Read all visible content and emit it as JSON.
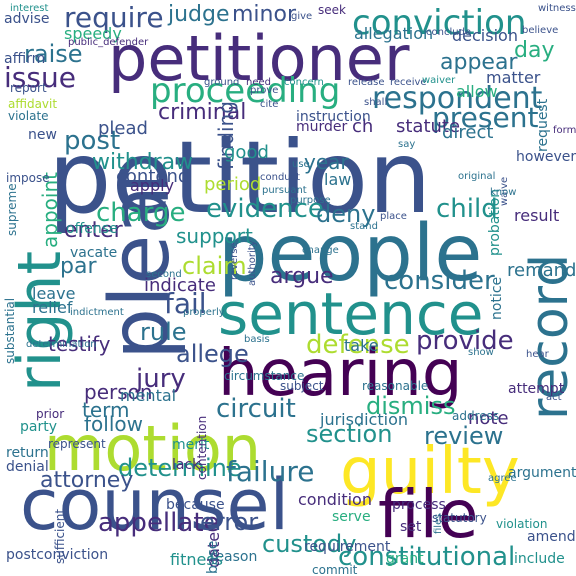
{
  "palette": {
    "dark_purple": "#440154",
    "purple": "#472d7b",
    "indigo": "#3b528b",
    "blue": "#2c728e",
    "teal": "#21918c",
    "green": "#28ae80",
    "light_green": "#5ec962",
    "lime": "#addc30",
    "yellow": "#fde725"
  },
  "words": [
    {
      "text": "petition",
      "color": "#3b528b",
      "orientation": "horizontal"
    },
    {
      "text": "petitioner",
      "color": "#472d7b",
      "orientation": "horizontal"
    },
    {
      "text": "people",
      "color": "#2c728e",
      "orientation": "horizontal"
    },
    {
      "text": "counsel",
      "color": "#3b528b",
      "orientation": "horizontal"
    },
    {
      "text": "hearing",
      "color": "#440154",
      "orientation": "horizontal"
    },
    {
      "text": "motion",
      "color": "#addc30",
      "orientation": "horizontal"
    },
    {
      "text": "sentence",
      "color": "#21918c",
      "orientation": "horizontal"
    },
    {
      "text": "plea",
      "color": "#3b528b",
      "orientation": "vertical"
    },
    {
      "text": "right",
      "color": "#21918c",
      "orientation": "vertical"
    },
    {
      "text": "guilty",
      "color": "#fde725",
      "orientation": "horizontal"
    },
    {
      "text": "file",
      "color": "#440154",
      "orientation": "horizontal"
    },
    {
      "text": "record",
      "color": "#2c728e",
      "orientation": "vertical"
    },
    {
      "text": "conviction",
      "color": "#21918c",
      "orientation": "horizontal"
    },
    {
      "text": "proceeding",
      "color": "#28ae80",
      "orientation": "horizontal"
    },
    {
      "text": "respondent",
      "color": "#2c728e",
      "orientation": "horizontal"
    },
    {
      "text": "evidence",
      "color": "#21918c",
      "orientation": "horizontal"
    },
    {
      "text": "require",
      "color": "#3b528b",
      "orientation": "horizontal"
    },
    {
      "text": "issue",
      "color": "#472d7b",
      "orientation": "horizontal"
    },
    {
      "text": "raise",
      "color": "#2c728e",
      "orientation": "horizontal"
    },
    {
      "text": "judge",
      "color": "#2c728e",
      "orientation": "horizontal"
    },
    {
      "text": "minor",
      "color": "#3b528b",
      "orientation": "horizontal"
    },
    {
      "text": "day",
      "color": "#28ae80",
      "orientation": "horizontal"
    },
    {
      "text": "appear",
      "color": "#2c728e",
      "orientation": "horizontal"
    },
    {
      "text": "present",
      "color": "#2c728e",
      "orientation": "horizontal"
    },
    {
      "text": "post",
      "color": "#2c728e",
      "orientation": "horizontal"
    },
    {
      "text": "criminal",
      "color": "#472d7b",
      "orientation": "horizontal"
    },
    {
      "text": "withdraw",
      "color": "#21918c",
      "orientation": "horizontal"
    },
    {
      "text": "appoint",
      "color": "#28ae80",
      "orientation": "vertical"
    },
    {
      "text": "charge",
      "color": "#28ae80",
      "orientation": "horizontal"
    },
    {
      "text": "deny",
      "color": "#2c728e",
      "orientation": "horizontal"
    },
    {
      "text": "child",
      "color": "#21918c",
      "orientation": "horizontal"
    },
    {
      "text": "enter",
      "color": "#472d7b",
      "orientation": "horizontal"
    },
    {
      "text": "support",
      "color": "#21918c",
      "orientation": "horizontal"
    },
    {
      "text": "claim",
      "color": "#addc30",
      "orientation": "horizontal"
    },
    {
      "text": "consider",
      "color": "#2c728e",
      "orientation": "horizontal"
    },
    {
      "text": "argue",
      "color": "#472d7b",
      "orientation": "horizontal"
    },
    {
      "text": "par",
      "color": "#2c728e",
      "orientation": "horizontal"
    },
    {
      "text": "fail",
      "color": "#3b528b",
      "orientation": "horizontal"
    },
    {
      "text": "rule",
      "color": "#2c728e",
      "orientation": "horizontal"
    },
    {
      "text": "defense",
      "color": "#addc30",
      "orientation": "horizontal"
    },
    {
      "text": "provide",
      "color": "#472d7b",
      "orientation": "horizontal"
    },
    {
      "text": "allege",
      "color": "#3b528b",
      "orientation": "horizontal"
    },
    {
      "text": "jury",
      "color": "#472d7b",
      "orientation": "horizontal"
    },
    {
      "text": "circuit",
      "color": "#2c728e",
      "orientation": "horizontal"
    },
    {
      "text": "dismiss",
      "color": "#28ae80",
      "orientation": "horizontal"
    },
    {
      "text": "section",
      "color": "#21918c",
      "orientation": "horizontal"
    },
    {
      "text": "review",
      "color": "#2c728e",
      "orientation": "horizontal"
    },
    {
      "text": "note",
      "color": "#472d7b",
      "orientation": "horizontal"
    },
    {
      "text": "determine",
      "color": "#21918c",
      "orientation": "horizontal"
    },
    {
      "text": "failure",
      "color": "#2c728e",
      "orientation": "horizontal"
    },
    {
      "text": "attorney",
      "color": "#3b528b",
      "orientation": "horizontal"
    },
    {
      "text": "appellate",
      "color": "#472d7b",
      "orientation": "horizontal"
    },
    {
      "text": "error",
      "color": "#3b528b",
      "orientation": "horizontal"
    },
    {
      "text": "custody",
      "color": "#21918c",
      "orientation": "horizontal"
    },
    {
      "text": "constitutional",
      "color": "#21918c",
      "orientation": "horizontal"
    },
    {
      "text": "person",
      "color": "#472d7b",
      "orientation": "horizontal"
    },
    {
      "text": "term",
      "color": "#2c728e",
      "orientation": "horizontal"
    },
    {
      "text": "follow",
      "color": "#2c728e",
      "orientation": "horizontal"
    },
    {
      "text": "testify",
      "color": "#472d7b",
      "orientation": "horizontal"
    },
    {
      "text": "finding",
      "color": "#3b528b",
      "orientation": "vertical"
    },
    {
      "text": "good",
      "color": "#21918c",
      "orientation": "horizontal"
    },
    {
      "text": "period",
      "color": "#addc30",
      "orientation": "horizontal"
    },
    {
      "text": "year",
      "color": "#2c728e",
      "orientation": "horizontal"
    },
    {
      "text": "ch",
      "color": "#472d7b",
      "orientation": "horizontal"
    },
    {
      "text": "statute",
      "color": "#472d7b",
      "orientation": "horizontal"
    },
    {
      "text": "direct",
      "color": "#2c728e",
      "orientation": "horizontal"
    },
    {
      "text": "plead",
      "color": "#3b528b",
      "orientation": "horizontal"
    },
    {
      "text": "contend",
      "color": "#3b528b",
      "orientation": "horizontal"
    },
    {
      "text": "apply",
      "color": "#472d7b",
      "orientation": "horizontal"
    },
    {
      "text": "law",
      "color": "#2c728e",
      "orientation": "horizontal"
    },
    {
      "text": "jurisdiction",
      "color": "#2c728e",
      "orientation": "horizontal"
    },
    {
      "text": "indicate",
      "color": "#472d7b",
      "orientation": "horizontal"
    },
    {
      "text": "mental",
      "color": "#2c728e",
      "orientation": "horizontal"
    },
    {
      "text": "take",
      "color": "#2c728e",
      "orientation": "horizontal"
    },
    {
      "text": "remand",
      "color": "#2c728e",
      "orientation": "horizontal"
    },
    {
      "text": "relief",
      "color": "#2c728e",
      "orientation": "horizontal"
    },
    {
      "text": "leave",
      "color": "#2c728e",
      "orientation": "horizontal"
    },
    {
      "text": "offense",
      "color": "#21918c",
      "orientation": "horizontal"
    },
    {
      "text": "vacate",
      "color": "#2c728e",
      "orientation": "horizontal"
    },
    {
      "text": "result",
      "color": "#472d7b",
      "orientation": "horizontal"
    },
    {
      "text": "probation",
      "color": "#21918c",
      "orientation": "vertical"
    },
    {
      "text": "notice",
      "color": "#2c728e",
      "orientation": "vertical"
    },
    {
      "text": "request",
      "color": "#2c728e",
      "orientation": "vertical"
    },
    {
      "text": "however",
      "color": "#3b528b",
      "orientation": "horizontal"
    },
    {
      "text": "matter",
      "color": "#3b528b",
      "orientation": "horizontal"
    },
    {
      "text": "allow",
      "color": "#28ae80",
      "orientation": "horizontal"
    },
    {
      "text": "instruction",
      "color": "#3b528b",
      "orientation": "horizontal"
    },
    {
      "text": "murder",
      "color": "#472d7b",
      "orientation": "horizontal"
    },
    {
      "text": "decision",
      "color": "#3b528b",
      "orientation": "horizontal"
    },
    {
      "text": "allegation",
      "color": "#2c728e",
      "orientation": "horizontal"
    },
    {
      "text": "affirm",
      "color": "#3b528b",
      "orientation": "horizontal"
    },
    {
      "text": "speedy",
      "color": "#28ae80",
      "orientation": "horizontal"
    },
    {
      "text": "advise",
      "color": "#3b528b",
      "orientation": "horizontal"
    },
    {
      "text": "because",
      "color": "#3b528b",
      "orientation": "horizontal"
    },
    {
      "text": "new",
      "color": "#3b528b",
      "orientation": "horizontal"
    },
    {
      "text": "merit",
      "color": "#21918c",
      "orientation": "horizontal"
    },
    {
      "text": "lack",
      "color": "#472d7b",
      "orientation": "horizontal"
    },
    {
      "text": "reason",
      "color": "#2c728e",
      "orientation": "horizontal"
    },
    {
      "text": "fitness",
      "color": "#21918c",
      "orientation": "horizontal"
    },
    {
      "text": "date",
      "color": "#472d7b",
      "orientation": "vertical"
    },
    {
      "text": "serve",
      "color": "#28ae80",
      "orientation": "horizontal"
    },
    {
      "text": "condition",
      "color": "#472d7b",
      "orientation": "horizontal"
    },
    {
      "text": "requirement",
      "color": "#3b528b",
      "orientation": "horizontal"
    },
    {
      "text": "process",
      "color": "#472d7b",
      "orientation": "horizontal"
    },
    {
      "text": "set",
      "color": "#472d7b",
      "orientation": "horizontal"
    },
    {
      "text": "grant",
      "color": "#28ae80",
      "orientation": "horizontal"
    },
    {
      "text": "include",
      "color": "#21918c",
      "orientation": "horizontal"
    },
    {
      "text": "amend",
      "color": "#3b528b",
      "orientation": "horizontal"
    },
    {
      "text": "violation",
      "color": "#21918c",
      "orientation": "horizontal"
    },
    {
      "text": "statutory",
      "color": "#3b528b",
      "orientation": "horizontal"
    },
    {
      "text": "argument",
      "color": "#2c728e",
      "orientation": "horizontal"
    },
    {
      "text": "attempt",
      "color": "#472d7b",
      "orientation": "horizontal"
    },
    {
      "text": "address",
      "color": "#2c728e",
      "orientation": "horizontal"
    },
    {
      "text": "reasonable",
      "color": "#2c728e",
      "orientation": "horizontal"
    },
    {
      "text": "subject",
      "color": "#3b528b",
      "orientation": "horizontal"
    },
    {
      "text": "circumstance",
      "color": "#2c728e",
      "orientation": "horizontal"
    },
    {
      "text": "represent",
      "color": "#3b528b",
      "orientation": "horizontal"
    },
    {
      "text": "prior",
      "color": "#472d7b",
      "orientation": "horizontal"
    },
    {
      "text": "party",
      "color": "#21918c",
      "orientation": "horizontal"
    },
    {
      "text": "return",
      "color": "#2c728e",
      "orientation": "horizontal"
    },
    {
      "text": "denial",
      "color": "#3b528b",
      "orientation": "horizontal"
    },
    {
      "text": "postconviction",
      "color": "#3b528b",
      "orientation": "horizontal"
    },
    {
      "text": "sufficient",
      "color": "#3b528b",
      "orientation": "vertical"
    },
    {
      "text": "base",
      "color": "#2c728e",
      "orientation": "vertical"
    },
    {
      "text": "contention",
      "color": "#472d7b",
      "orientation": "vertical"
    },
    {
      "text": "commit",
      "color": "#2c728e",
      "orientation": "horizontal"
    },
    {
      "text": "substantial",
      "color": "#2c728e",
      "orientation": "vertical"
    },
    {
      "text": "supreme",
      "color": "#2c728e",
      "orientation": "vertical"
    },
    {
      "text": "impose",
      "color": "#3b528b",
      "orientation": "horizontal"
    },
    {
      "text": "violate",
      "color": "#2c728e",
      "orientation": "horizontal"
    },
    {
      "text": "affidavit",
      "color": "#addc30",
      "orientation": "horizontal"
    },
    {
      "text": "report",
      "color": "#3b528b",
      "orientation": "horizontal"
    },
    {
      "text": "ground",
      "color": "#3b528b",
      "orientation": "horizontal"
    },
    {
      "text": "concern",
      "color": "#21918c",
      "orientation": "horizontal"
    },
    {
      "text": "public_defender",
      "color": "#472d7b",
      "orientation": "horizontal"
    },
    {
      "text": "interest",
      "color": "#21918c",
      "orientation": "horizontal"
    },
    {
      "text": "give",
      "color": "#3b528b",
      "orientation": "horizontal"
    },
    {
      "text": "seek",
      "color": "#472d7b",
      "orientation": "horizontal"
    },
    {
      "text": "witness",
      "color": "#3b528b",
      "orientation": "horizontal"
    },
    {
      "text": "believe",
      "color": "#3b528b",
      "orientation": "horizontal"
    },
    {
      "text": "conclude",
      "color": "#3b528b",
      "orientation": "horizontal"
    },
    {
      "text": "release",
      "color": "#3b528b",
      "orientation": "horizontal"
    },
    {
      "text": "receive",
      "color": "#3b528b",
      "orientation": "horizontal"
    },
    {
      "text": "waiver",
      "color": "#21918c",
      "orientation": "horizontal"
    },
    {
      "text": "shall",
      "color": "#3b528b",
      "orientation": "horizontal"
    },
    {
      "text": "say",
      "color": "#2c728e",
      "orientation": "horizontal"
    },
    {
      "text": "form",
      "color": "#472d7b",
      "orientation": "horizontal"
    },
    {
      "text": "need",
      "color": "#472d7b",
      "orientation": "horizontal"
    },
    {
      "text": "prove",
      "color": "#3b528b",
      "orientation": "horizontal"
    },
    {
      "text": "cite",
      "color": "#3b528b",
      "orientation": "horizontal"
    },
    {
      "text": "use",
      "color": "#2c728e",
      "orientation": "horizontal"
    },
    {
      "text": "conduct",
      "color": "#3b528b",
      "orientation": "horizontal"
    },
    {
      "text": "original",
      "color": "#2c728e",
      "orientation": "horizontal"
    },
    {
      "text": "place",
      "color": "#3b528b",
      "orientation": "horizontal"
    },
    {
      "text": "stand",
      "color": "#2c728e",
      "orientation": "horizontal"
    },
    {
      "text": "pursuant",
      "color": "#2c728e",
      "orientation": "horizontal"
    },
    {
      "text": "purpose",
      "color": "#2c728e",
      "orientation": "horizontal"
    },
    {
      "text": "change",
      "color": "#2c728e",
      "orientation": "horizontal"
    },
    {
      "text": "reverse",
      "color": "#3b528b",
      "orientation": "vertical"
    },
    {
      "text": "authority",
      "color": "#3b528b",
      "orientation": "vertical"
    },
    {
      "text": "waive",
      "color": "#3b528b",
      "orientation": "vertical"
    },
    {
      "text": "know",
      "color": "#2c728e",
      "orientation": "horizontal"
    },
    {
      "text": "second",
      "color": "#2c728e",
      "orientation": "horizontal"
    },
    {
      "text": "basis",
      "color": "#2c728e",
      "orientation": "horizontal"
    },
    {
      "text": "properly",
      "color": "#2c728e",
      "orientation": "horizontal"
    },
    {
      "text": "indictment",
      "color": "#2c728e",
      "orientation": "horizontal"
    },
    {
      "text": "determination",
      "color": "#2c728e",
      "orientation": "horizontal"
    },
    {
      "text": "show",
      "color": "#2c728e",
      "orientation": "horizontal"
    },
    {
      "text": "hear",
      "color": "#3b528b",
      "orientation": "horizontal"
    },
    {
      "text": "act",
      "color": "#3b528b",
      "orientation": "horizontal"
    },
    {
      "text": "agree",
      "color": "#2c728e",
      "orientation": "horizontal"
    },
    {
      "text": "files",
      "color": "#2c728e",
      "orientation": "vertical"
    }
  ]
}
